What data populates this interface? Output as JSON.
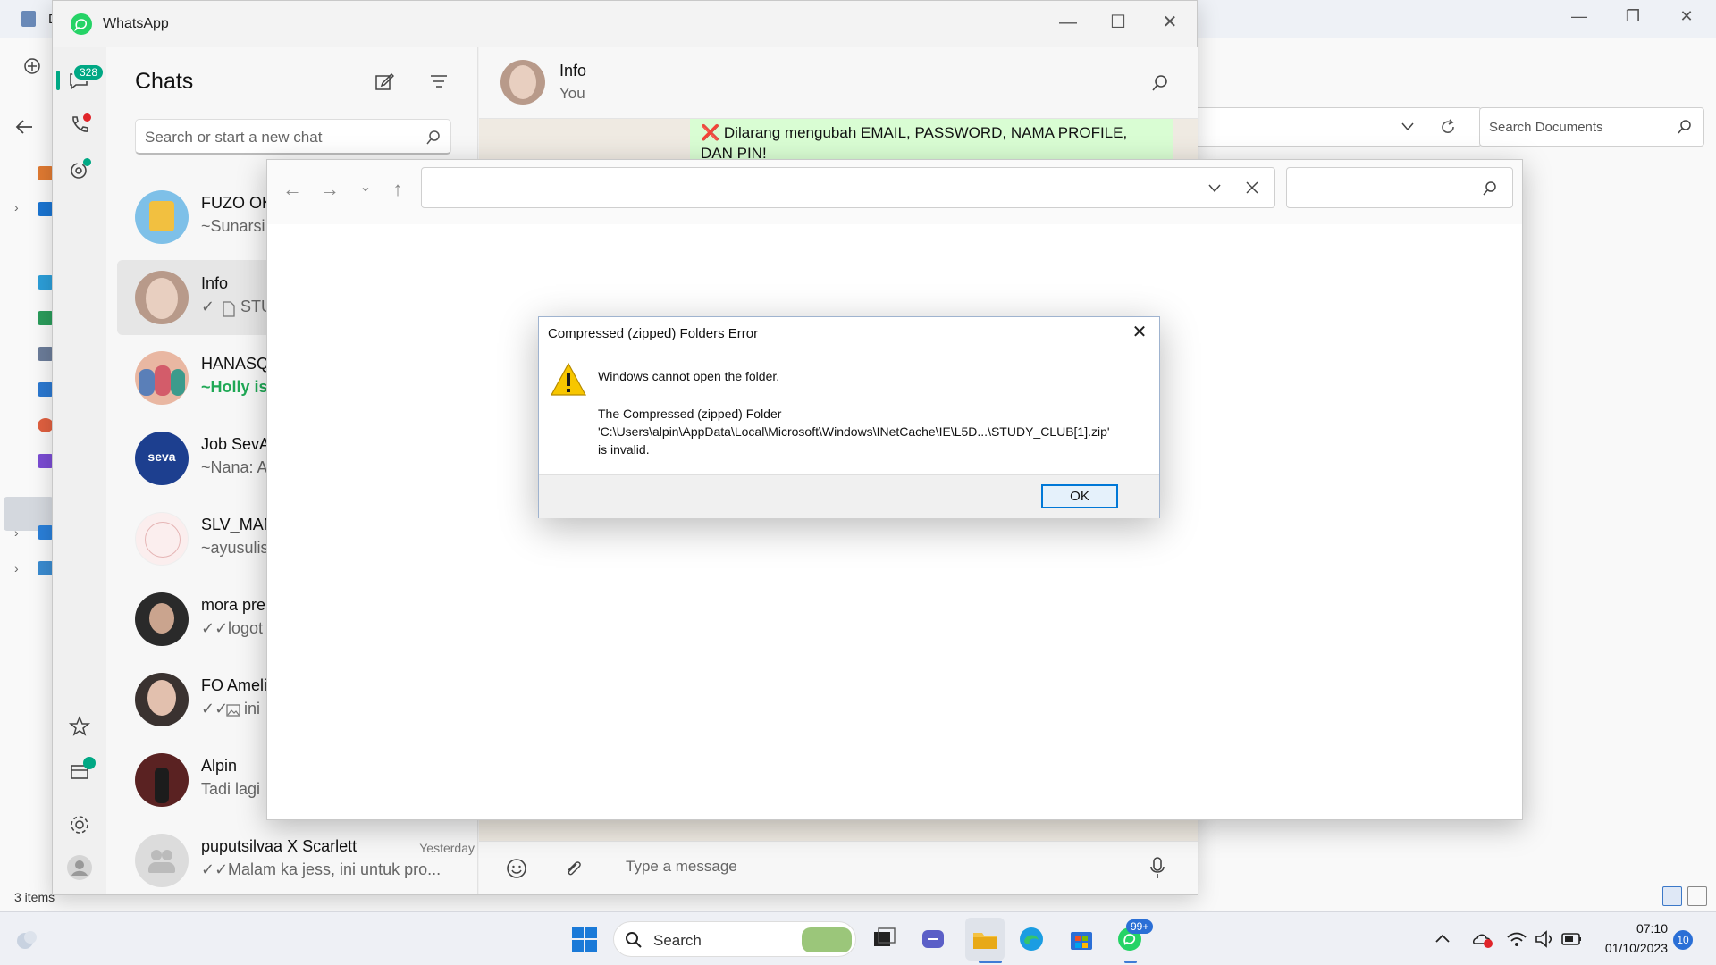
{
  "explorer_bg": {
    "tab_text": "D",
    "search_placeholder": "Search Documents",
    "status": "3 items"
  },
  "whatsapp": {
    "title": "WhatsApp",
    "rail": {
      "chats_badge": "328"
    },
    "chat_list": {
      "heading": "Chats",
      "search_placeholder": "Search or start a new chat",
      "chats": [
        {
          "name": "FUZO OK",
          "preview": "~Sunarsi"
        },
        {
          "name": "Info",
          "preview": "STU"
        },
        {
          "name": "HANASQ",
          "preview": "~Holly is"
        },
        {
          "name": "Job SevA",
          "preview": "~Nana: A"
        },
        {
          "name": "SLV_MAN",
          "preview": "~ayusulis"
        },
        {
          "name": "mora pre",
          "preview": "logot"
        },
        {
          "name": "FO Ameli",
          "preview": "ini"
        },
        {
          "name": "Alpin",
          "preview": "Tadi lagi"
        },
        {
          "name": "puputsilvaa X Scarlett",
          "preview": "Malam ka jess, ini untuk pro...",
          "time": "Yesterday"
        }
      ]
    },
    "conversation": {
      "name": "Info",
      "subtitle": "You",
      "message": "Dilarang mengubah EMAIL, PASSWORD, NAMA PROFILE, DAN PIN!",
      "compose_placeholder": "Type a message"
    }
  },
  "dialog": {
    "title": "Compressed (zipped) Folders Error",
    "main_text": "Windows cannot open the folder.",
    "detail_line1": "The Compressed (zipped) Folder",
    "detail_line2": "'C:\\Users\\alpin\\AppData\\Local\\Microsoft\\Windows\\INetCache\\IE\\L5D...\\STUDY_CLUB[1].zip'",
    "detail_line3": "is invalid.",
    "ok_label": "OK"
  },
  "taskbar": {
    "search_label": "Search",
    "whatsapp_badge": "99+",
    "time": "07:10",
    "date": "01/10/2023",
    "notification_count": "10"
  },
  "colors": {
    "whatsapp_green": "#25d366",
    "accent_teal": "#00a884",
    "dialog_ok_border": "#0078d7",
    "warning_yellow": "#f7c600",
    "error_red": "#e0252a"
  }
}
